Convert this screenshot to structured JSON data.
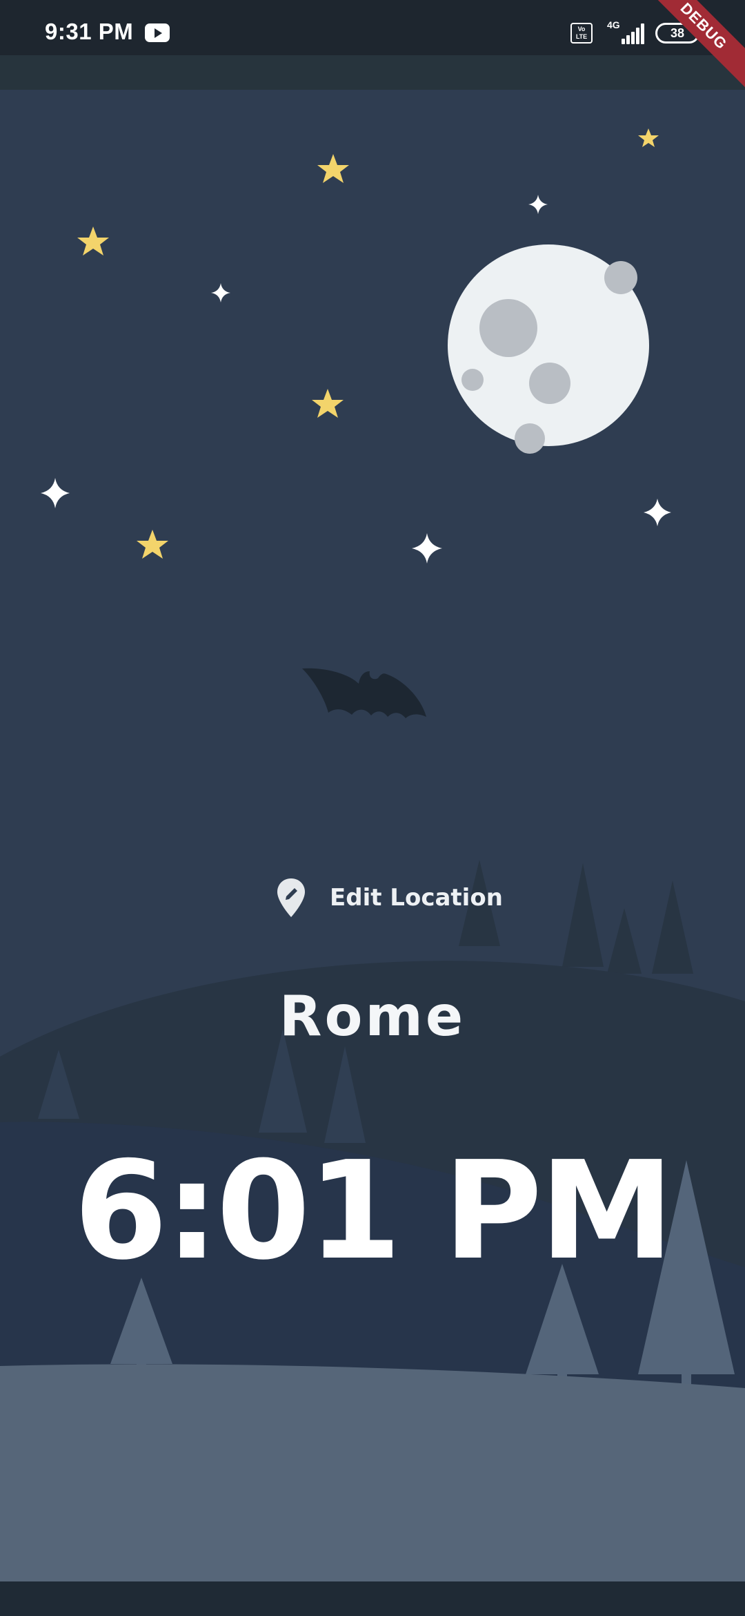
{
  "status_bar": {
    "time": "9:31 PM",
    "volte": "Vo LTE",
    "network": "4G",
    "battery": "38"
  },
  "debug_banner": "DEBUG",
  "location": {
    "edit_label": "Edit Location",
    "city": "Rome",
    "time": "6:01 PM"
  },
  "colors": {
    "sky": "#2f3d51",
    "moon": "#edf1f3",
    "star_gold": "#f3d46b",
    "star_white": "#ffffff",
    "ground": "#566679"
  },
  "icons": {
    "location_pin": "edit-location-pin-icon",
    "video": "youtube-icon"
  }
}
